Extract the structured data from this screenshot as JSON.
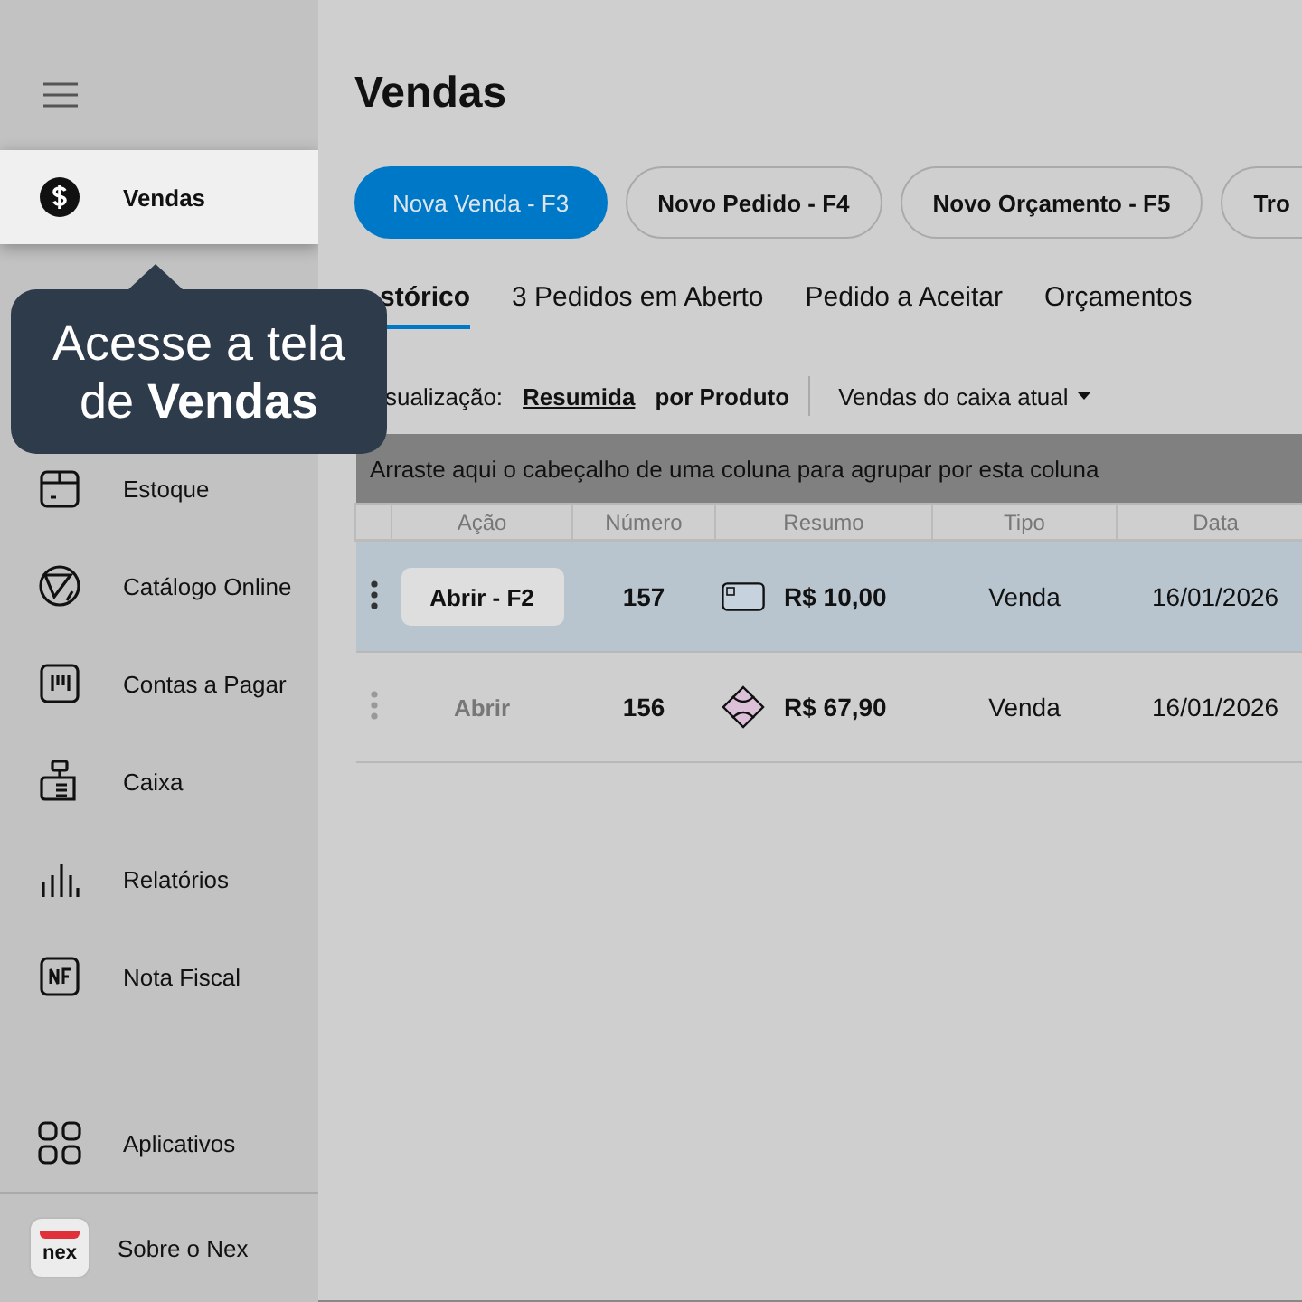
{
  "sidebar": {
    "items": [
      {
        "label": "Vendas",
        "selected": true
      },
      {
        "label": "Estoque",
        "selected": false
      },
      {
        "label": "Catálogo Online",
        "selected": false
      },
      {
        "label": "Contas a Pagar",
        "selected": false
      },
      {
        "label": "Caixa",
        "selected": false
      },
      {
        "label": "Relatórios",
        "selected": false
      },
      {
        "label": "Nota Fiscal",
        "selected": false
      }
    ],
    "apps": {
      "label": "Aplicativos"
    },
    "about": {
      "label": "Sobre o Nex",
      "logo_text": "nex"
    }
  },
  "tooltip": {
    "text": "Acesse a tela de **Vendas**"
  },
  "page": {
    "title": "Vendas"
  },
  "actions": [
    {
      "label": "Nova Venda - F3",
      "primary": true
    },
    {
      "label": "Novo Pedido - F4",
      "primary": false
    },
    {
      "label": "Novo Orçamento - F5",
      "primary": false
    },
    {
      "label": "Tro",
      "primary": false
    }
  ],
  "tabs": [
    {
      "label": "stórico",
      "selected": true
    },
    {
      "label": "3 Pedidos em Aberto",
      "selected": false
    },
    {
      "label": "Pedido a Aceitar",
      "selected": false
    },
    {
      "label": "Orçamentos",
      "selected": false
    }
  ],
  "view": {
    "label": "sualização:",
    "options": [
      {
        "label": "Resumida",
        "selected": true
      },
      {
        "label": "por Produto",
        "selected": false
      }
    ],
    "filter": "Vendas do caixa atual"
  },
  "table": {
    "group_hint": "Arraste aqui o cabeçalho de uma coluna para agrupar por esta coluna",
    "columns": [
      "Ação",
      "Número",
      "Resumo",
      "Tipo",
      "Data"
    ],
    "rows": [
      {
        "action": "Abrir - F2",
        "number": "157",
        "amount": "R$ 10,00",
        "type": "Venda",
        "date": "16/01/2026",
        "selected": true
      },
      {
        "action": "Abrir",
        "number": "156",
        "amount": "R$ 67,90",
        "type": "Venda",
        "date": "16/01/2026",
        "selected": false
      }
    ]
  }
}
